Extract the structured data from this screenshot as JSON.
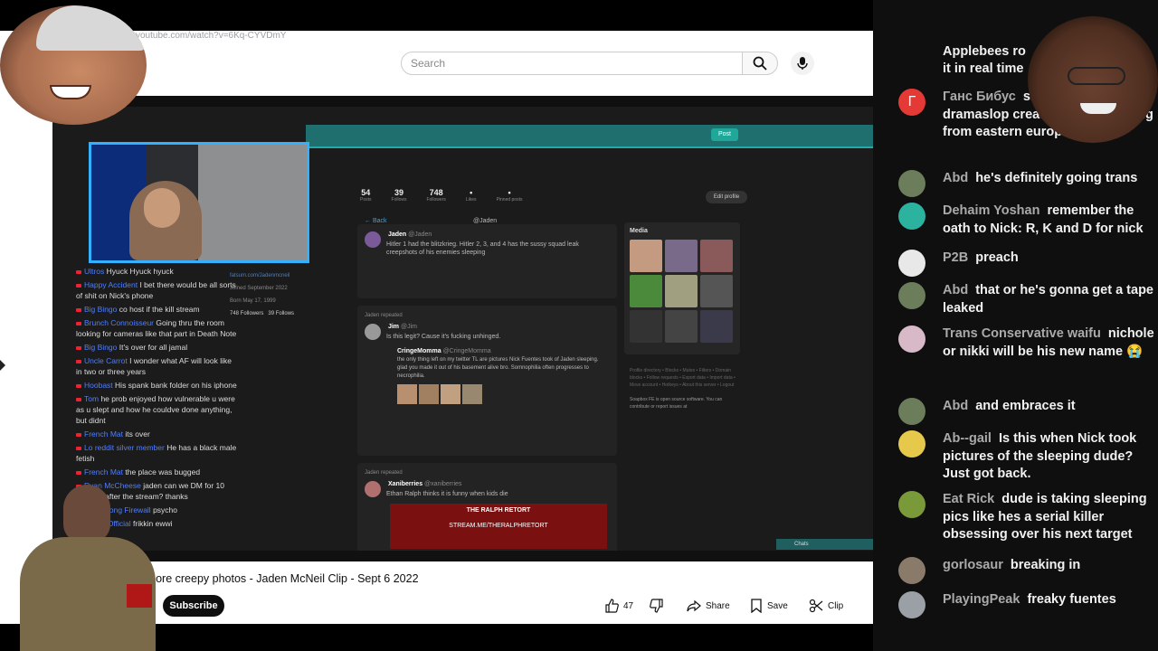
{
  "browser": {
    "url": "youtube.com/watch?v=6Kq-CYVDmY",
    "search_placeholder": "Search"
  },
  "video": {
    "stream_chat": [
      {
        "user": "Ultros",
        "text": "Hyuck Hyuck hyuck"
      },
      {
        "user": "Happy Accident",
        "text": "I bet there would be all sorts of shit on Nick's phone"
      },
      {
        "user": "Big Bingo",
        "text": "co host if the kill stream"
      },
      {
        "user": "Brunch Connoisseur",
        "text": "Going thru the room looking for cameras like that part in Death Note"
      },
      {
        "user": "Big Bingo",
        "text": "It's over for all jamal"
      },
      {
        "user": "Uncle Carrot",
        "text": "I wonder what AF will look like in two or three years"
      },
      {
        "user": "Hoobast",
        "text": "His spank bank folder on his iphone"
      },
      {
        "user": "Tom",
        "text": "he prob enjoyed how vulnerable u were as u slept and how he couldve done anything, but didnt"
      },
      {
        "user": "French Mat",
        "text": "its over"
      },
      {
        "user": "Lo reddit silver member",
        "text": "He has a black male fetish"
      },
      {
        "user": "French Mat",
        "text": "the place was bugged"
      },
      {
        "user": "Ryan McCheese",
        "text": "jaden can we DM for 10 minutes after the stream? thanks"
      },
      {
        "user": "The Strong Firewall",
        "text": "psycho"
      },
      {
        "user": "NCSP Official",
        "text": "frikkin ewwi"
      }
    ],
    "profile": {
      "link": "fatsum.com/Jadenmcneil",
      "joined": "Joined September 2022",
      "born": "Born May 17, 1999",
      "followers": "748 Followers",
      "following": "39 Follows"
    },
    "stats": [
      {
        "value": "54",
        "label": "Posts"
      },
      {
        "value": "39",
        "label": "Follows"
      },
      {
        "value": "748",
        "label": "Followers"
      },
      {
        "value": "•",
        "label": "Likes"
      },
      {
        "value": "•",
        "label": "Pinned posts"
      }
    ],
    "edit_profile": "Edit profile",
    "post_button": "Post",
    "back_label": "Back",
    "handle": "@Jaden",
    "posts": [
      {
        "repost": "",
        "author": "Jaden",
        "handle": "@Jaden",
        "text": "Hitler 1 had the blitzkrieg. Hitler 2, 3, and 4 has the sussy squad leak creepshots of his enemies sleeping"
      },
      {
        "repost": "Jaden repeated",
        "author": "Jim",
        "handle": "@Jim",
        "text": "Is this legit? Cause it's fucking unhinged.",
        "quote_author": "CringeMomma",
        "quote_handle": "@CringeMomma",
        "quote_text": "the only thing left on my twitter TL are pictures Nick Fuentes took of Jaden sleeping. glad you made it out of his basement alive bro. Somnophilia often progresses to necrophilia."
      },
      {
        "repost": "Jaden repeated",
        "author": "Xaniberries",
        "handle": "@xaniberries",
        "text": "Ethan Ralph thinks it is funny when kids die",
        "banner": "THE RALPH RETORT",
        "banner2": "STREAM.ME/THERALPHRETORT"
      }
    ],
    "media_title": "Media",
    "side_links": "Profile directory • Blocks • Mutes • Filters • Domain blocks • Follow requests • Export data • Import data • Move account • Hotkeys • About this server • Logout",
    "soapbox_note": "Soapbox FE is open source software. You can contribute or report issues at",
    "chats_label": "Chats"
  },
  "video_info": {
    "title": "es more creepy photos - Jaden McNeil Clip - Sept 6 2022",
    "subscribe": "Subscribe",
    "likes": "47",
    "share": "Share",
    "save": "Save",
    "clip": "Clip"
  },
  "live_chat": {
    "top_cut_1": "Applebees ro",
    "top_cut_2": "it in real time",
    "messages": [
      {
        "author": "Ганс Бибус",
        "text": "smoothest and the dramaslop creator of yt, reporting from eastern europe",
        "avatar_letter": "Г",
        "avatar_color": "#e53935"
      },
      {
        "author": "Abd",
        "text": "he's definitely going trans",
        "avatar_color": "#6b7d5a"
      },
      {
        "author": "Dehaim Yoshan",
        "text": "remember the oath to Nick: R, K and D for nick",
        "avatar_color": "#2bb3a0"
      },
      {
        "author": "P2B",
        "text": "preach",
        "avatar_color": "#e8e8e8"
      },
      {
        "author": "Abd",
        "text": "that or he's gonna get a tape leaked",
        "avatar_color": "#6b7d5a"
      },
      {
        "author": "Trans Conservative waifu",
        "text": "nichole or nikki will be his new name 😭",
        "avatar_color": "#d8b9c8"
      },
      {
        "author": "Abd",
        "text": "and embraces it",
        "avatar_color": "#6b7d5a"
      },
      {
        "author": "Ab--gail",
        "text": "Is this when Nick took pictures of the sleeping dude? Just got back.",
        "avatar_color": "#e6c84a"
      },
      {
        "author": "Eat Rick",
        "text": "dude is taking sleeping pics like hes a serial killer obsessing over his next target",
        "avatar_color": "#7a9a3a"
      },
      {
        "author": "gorlosaur",
        "text": "breaking in",
        "avatar_color": "#8a7a6a"
      },
      {
        "author": "PlayingPeak",
        "text": "freaky fuentes",
        "avatar_color": "#9aa0a6"
      }
    ]
  }
}
